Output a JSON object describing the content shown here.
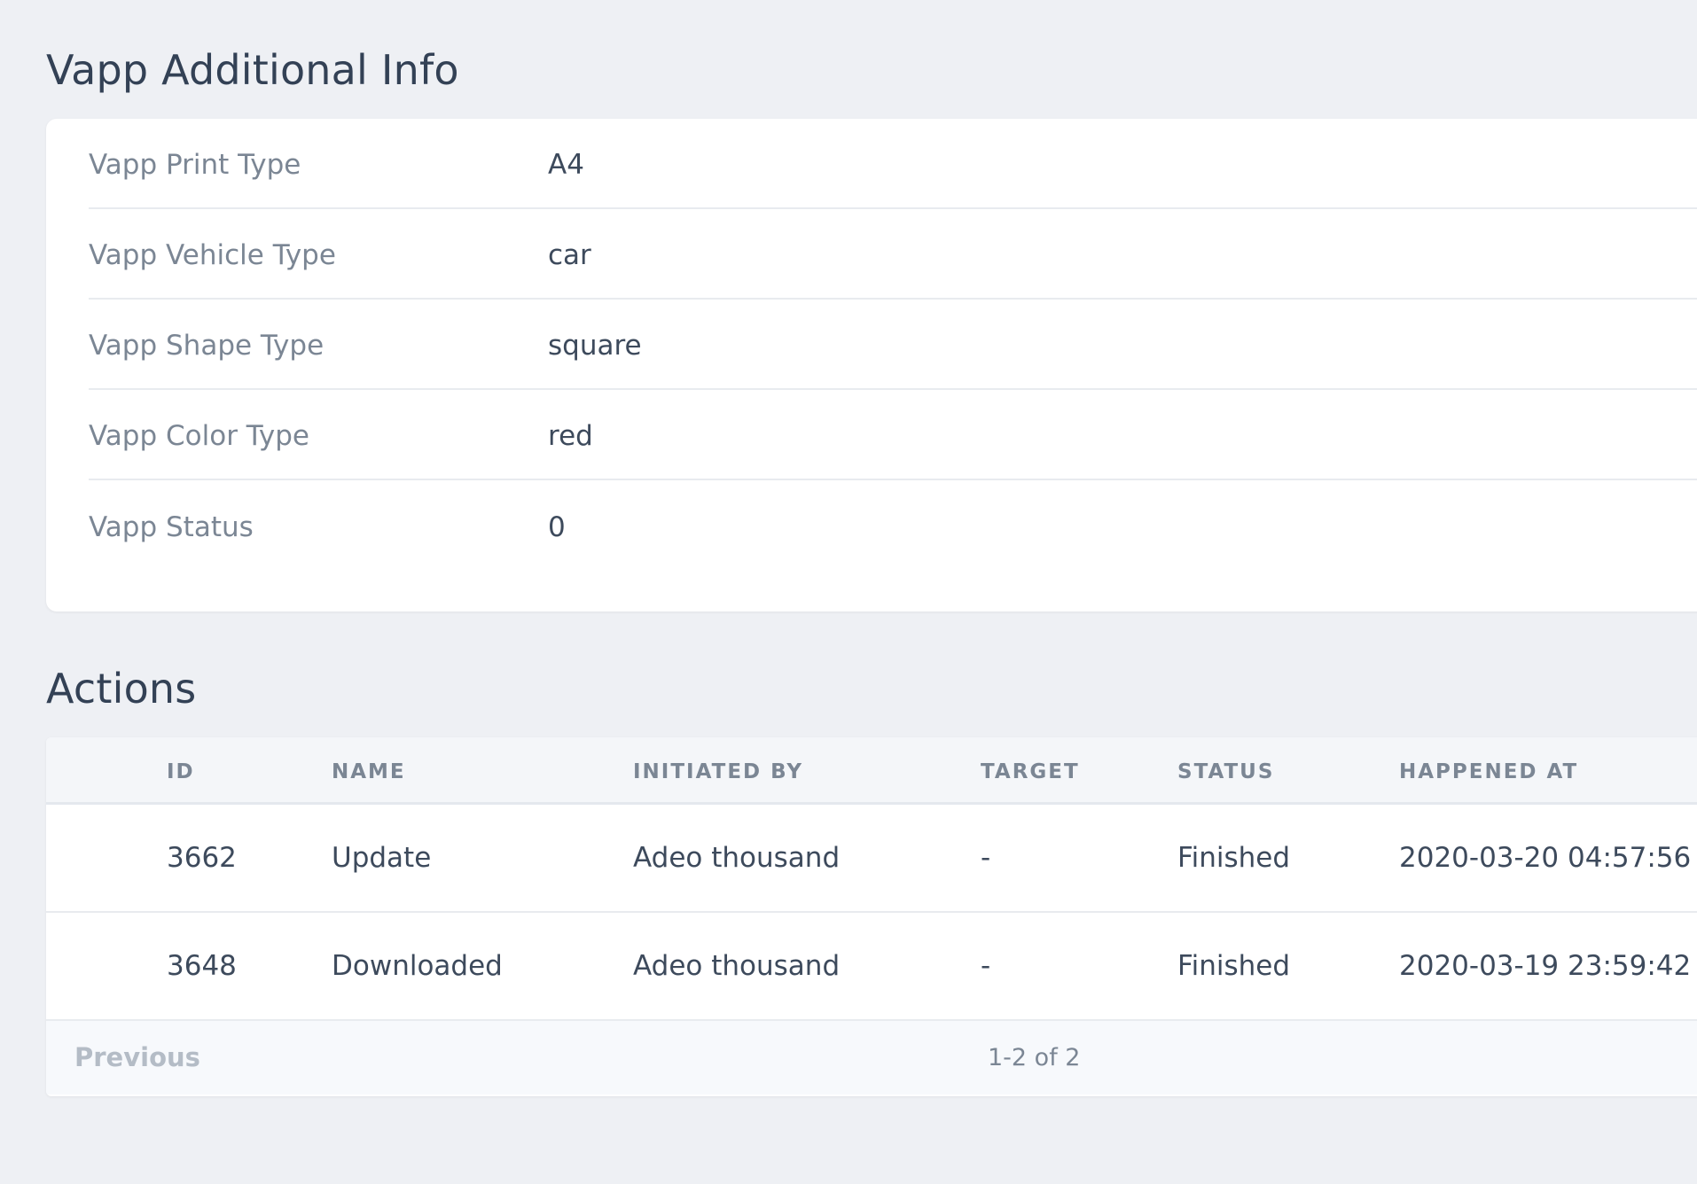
{
  "info": {
    "title": "Vapp Additional Info",
    "rows": [
      {
        "label": "Vapp Print Type",
        "value": "A4"
      },
      {
        "label": "Vapp Vehicle Type",
        "value": "car"
      },
      {
        "label": "Vapp Shape Type",
        "value": "square"
      },
      {
        "label": "Vapp Color Type",
        "value": "red"
      },
      {
        "label": "Vapp Status",
        "value": "0"
      }
    ]
  },
  "actions": {
    "title": "Actions",
    "columns": [
      "ID",
      "NAME",
      "INITIATED BY",
      "TARGET",
      "STATUS",
      "HAPPENED AT"
    ],
    "rows": [
      {
        "id": "3662",
        "name": "Update",
        "initiated_by": "Adeo thousand",
        "target": "-",
        "status": "Finished",
        "happened_at": "2020-03-20 04:57:56"
      },
      {
        "id": "3648",
        "name": "Downloaded",
        "initiated_by": "Adeo thousand",
        "target": "-",
        "status": "Finished",
        "happened_at": "2020-03-19 23:59:42"
      }
    ],
    "pagination": {
      "previous_label": "Previous",
      "range_text": "1-2 of 2"
    }
  }
}
